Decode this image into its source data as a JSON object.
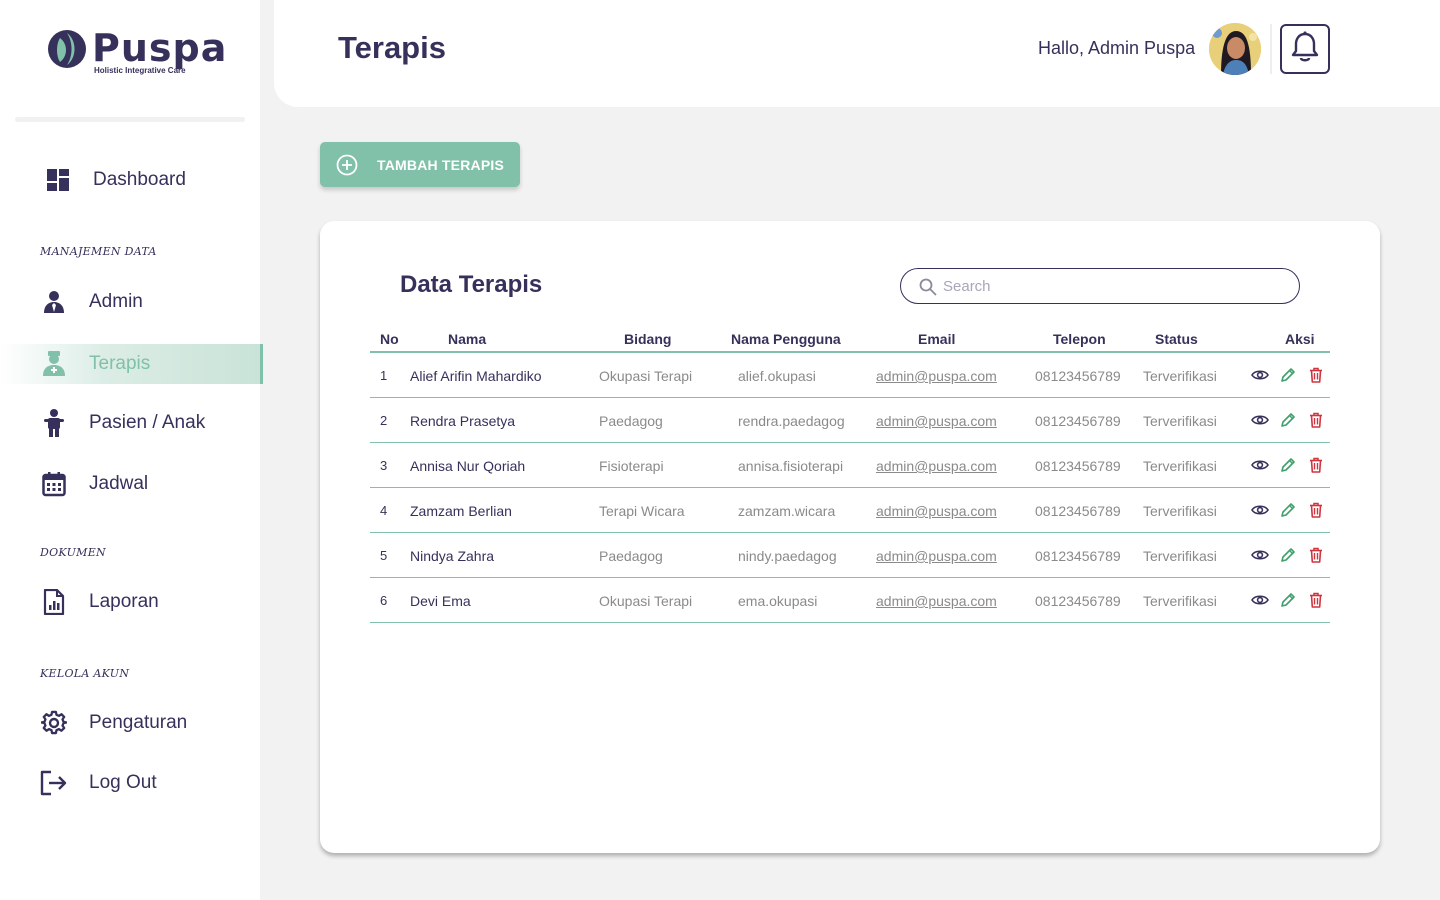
{
  "brand": {
    "name": "Puspa",
    "tagline": "Holistic Integrative Care"
  },
  "sidebar": {
    "dashboard": {
      "label": "Dashboard",
      "icon": "dashboard-icon"
    },
    "sections": [
      {
        "label": "MANAJEMEN DATA"
      },
      {
        "label": "DOKUMEN"
      },
      {
        "label": "KELOLA AKUN"
      }
    ],
    "items": [
      {
        "label": "Admin",
        "icon": "admin-icon",
        "active": false
      },
      {
        "label": "Terapis",
        "icon": "therapist-icon",
        "active": true
      },
      {
        "label": "Pasien / Anak",
        "icon": "child-icon",
        "active": false
      },
      {
        "label": "Jadwal",
        "icon": "calendar-icon",
        "active": false
      },
      {
        "label": "Laporan",
        "icon": "report-icon",
        "active": false
      },
      {
        "label": "Pengaturan",
        "icon": "gear-icon",
        "active": false
      },
      {
        "label": "Log Out",
        "icon": "logout-icon",
        "active": false
      }
    ]
  },
  "header": {
    "title": "Terapis",
    "greeting": "Hallo, Admin Puspa"
  },
  "add_button": {
    "label": "TAMBAH TERAPIS"
  },
  "card": {
    "title": "Data Terapis",
    "search_placeholder": "Search",
    "columns": [
      "No",
      "Nama",
      "Bidang",
      "Nama Pengguna",
      "Email",
      "Telepon",
      "Status",
      "Aksi"
    ],
    "rows": [
      {
        "no": "1",
        "nama": "Alief Arifin Mahardiko",
        "bidang": "Okupasi Terapi",
        "username": "alief.okupasi",
        "email": "admin@puspa.com",
        "telepon": "08123456789",
        "status": "Terverifikasi"
      },
      {
        "no": "2",
        "nama": "Rendra Prasetya",
        "bidang": "Paedagog",
        "username": "rendra.paedagog",
        "email": "admin@puspa.com",
        "telepon": "08123456789",
        "status": "Terverifikasi"
      },
      {
        "no": "3",
        "nama": "Annisa Nur Qoriah",
        "bidang": "Fisioterapi",
        "username": "annisa.fisioterapi",
        "email": "admin@puspa.com",
        "telepon": "08123456789",
        "status": "Terverifikasi"
      },
      {
        "no": "4",
        "nama": "Zamzam Berlian",
        "bidang": "Terapi Wicara",
        "username": "zamzam.wicara",
        "email": "admin@puspa.com",
        "telepon": "08123456789",
        "status": "Terverifikasi"
      },
      {
        "no": "5",
        "nama": "Nindya Zahra",
        "bidang": "Paedagog",
        "username": "nindy.paedagog",
        "email": "admin@puspa.com",
        "telepon": "08123456789",
        "status": "Terverifikasi"
      },
      {
        "no": "6",
        "nama": "Devi Ema",
        "bidang": "Okupasi Terapi",
        "username": "ema.okupasi",
        "email": "admin@puspa.com",
        "telepon": "08123456789",
        "status": "Terverifikasi"
      }
    ]
  },
  "colors": {
    "primary": "#36315b",
    "accent": "#81c0a9",
    "danger": "#d0343f",
    "edit": "#3ea06a"
  }
}
